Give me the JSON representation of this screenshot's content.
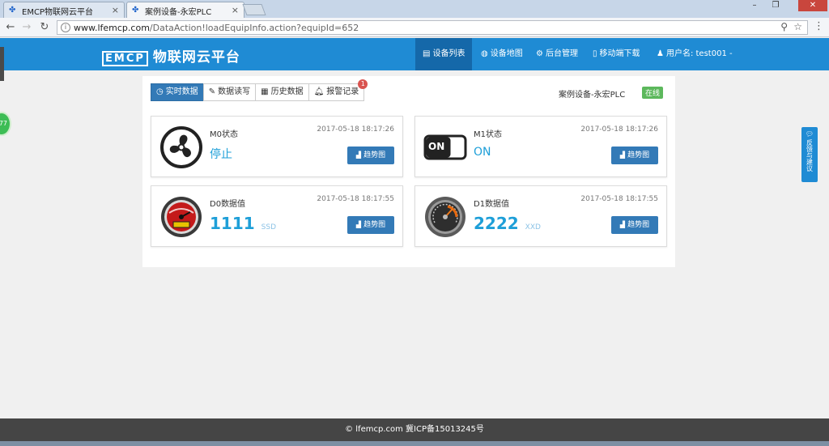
{
  "browser": {
    "tabs": [
      {
        "title": "EMCP物联网云平台",
        "active": false
      },
      {
        "title": "案例设备-永宏PLC",
        "active": true
      }
    ],
    "url_host": "www.lfemcp.com",
    "url_path": "/DataAction!loadEquipInfo.action?equipId=652"
  },
  "header": {
    "logo_mark": "EMCP",
    "logo_text": "物联网云平台",
    "nav": [
      {
        "label": "设备列表",
        "icon": "list-icon",
        "active": true
      },
      {
        "label": "设备地图",
        "icon": "globe-icon",
        "active": false
      },
      {
        "label": "后台管理",
        "icon": "cogs-icon",
        "active": false
      },
      {
        "label": "移动端下载",
        "icon": "mobile-icon",
        "active": false
      },
      {
        "label": "用户名: test001 -",
        "icon": "user-icon",
        "active": false
      }
    ]
  },
  "toolbar": {
    "tabs": [
      {
        "label": "实时数据",
        "icon": "clock-icon",
        "active": true
      },
      {
        "label": "数据读写",
        "icon": "pencil-icon",
        "active": false
      },
      {
        "label": "历史数据",
        "icon": "table-icon",
        "active": false
      },
      {
        "label": "报警记录",
        "icon": "bell-icon",
        "active": false,
        "badge": "1"
      }
    ],
    "device_name": "案例设备-永宏PLC",
    "status": "在线"
  },
  "cards": [
    {
      "name": "M0状态",
      "time": "2017-05-18 18:17:26",
      "value": "停止",
      "unit": "",
      "icon": "fan-icon",
      "button": "趋势图"
    },
    {
      "name": "M1状态",
      "time": "2017-05-18 18:17:26",
      "value": "ON",
      "unit": "",
      "icon": "switch-on-icon",
      "switch_text": "ON",
      "button": "趋势图"
    },
    {
      "name": "D0数据值",
      "time": "2017-05-18 18:17:55",
      "value": "1111",
      "unit": "SSD",
      "icon": "red-gauge-icon",
      "button": "趋势图"
    },
    {
      "name": "D1数据值",
      "time": "2017-05-18 18:17:55",
      "value": "2222",
      "unit": "XXD",
      "icon": "gray-gauge-icon",
      "button": "趋势图"
    }
  ],
  "side": {
    "feedback": "反馈与建议",
    "left_badge": "77"
  },
  "footer": {
    "text": "lfemcp.com 冀ICP备15013245号"
  },
  "colors": {
    "header_blue": "#1f8bd4",
    "nav_active": "#1568a9",
    "button_blue": "#337ab7",
    "value_blue": "#1e9fd8",
    "online_green": "#5cb85c",
    "footer_gray": "#454545"
  }
}
